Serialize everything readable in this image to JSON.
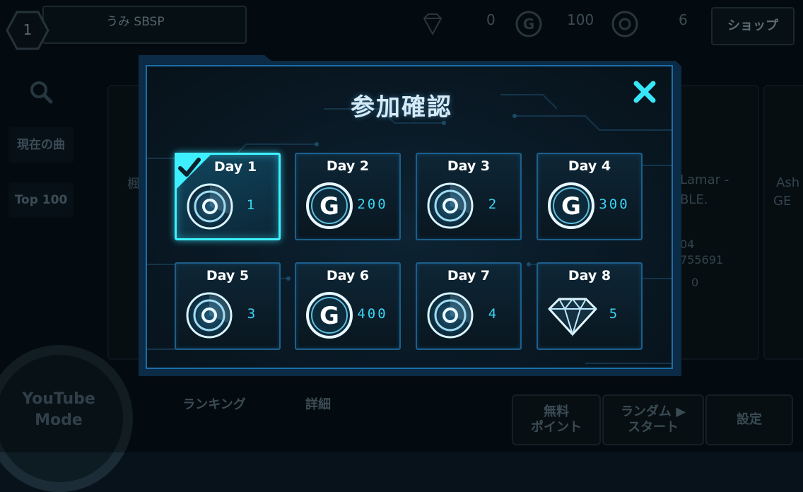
{
  "player": {
    "level": "1",
    "name": "うみ SBSP"
  },
  "currency": {
    "diamonds": "0",
    "gold": "100",
    "tickets": "6"
  },
  "header": {
    "shop_label": "ショップ"
  },
  "sidebar": {
    "items": [
      {
        "label": "現在の曲"
      },
      {
        "label": "Top 100"
      }
    ]
  },
  "background": {
    "right_song_title": "Lamar -",
    "right_song_sub": "BLE.",
    "right_song_time": "04",
    "right_song_id": "755691",
    "right_value": "0",
    "left_fragment": "楓",
    "far_right_fragment": "Ash",
    "far_right_fragment2": "GE"
  },
  "bottom": {
    "youtube_mode": [
      "YouTube",
      "Mode"
    ],
    "ranking": "ランキング",
    "detail": "詳細",
    "free_points": [
      "無料",
      "ポイント"
    ],
    "random_start": [
      "ランダム ▶",
      "スタート"
    ],
    "settings": "設定"
  },
  "modal": {
    "title": "参加確認",
    "days": [
      {
        "label": "Day 1",
        "reward": "ticket",
        "amount": "1",
        "claimed": true
      },
      {
        "label": "Day 2",
        "reward": "gold",
        "amount": "200",
        "claimed": false
      },
      {
        "label": "Day 3",
        "reward": "ticket",
        "amount": "2",
        "claimed": false
      },
      {
        "label": "Day 4",
        "reward": "gold",
        "amount": "300",
        "claimed": false
      },
      {
        "label": "Day 5",
        "reward": "ticket",
        "amount": "3",
        "claimed": false
      },
      {
        "label": "Day 6",
        "reward": "gold",
        "amount": "400",
        "claimed": false
      },
      {
        "label": "Day 7",
        "reward": "ticket",
        "amount": "4",
        "claimed": false
      },
      {
        "label": "Day 8",
        "reward": "diamond",
        "amount": "5",
        "claimed": false
      }
    ]
  },
  "colors": {
    "accent": "#3ef0ff",
    "frame": "#1d6ea8",
    "amount": "#39d6f5"
  }
}
